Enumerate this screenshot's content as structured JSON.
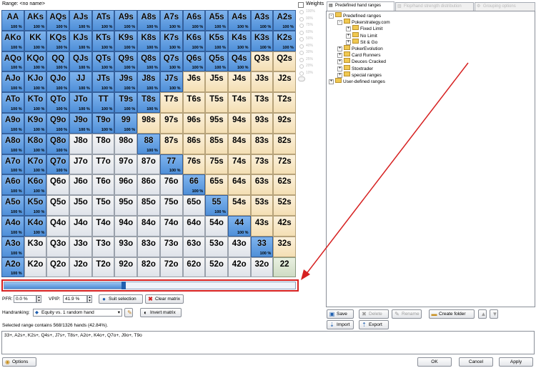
{
  "range_label": "Range: <no name>",
  "matrix": {
    "rows": [
      [
        [
          "AA",
          "s",
          1
        ],
        [
          "AKs",
          "s",
          1
        ],
        [
          "AQs",
          "s",
          1
        ],
        [
          "AJs",
          "s",
          1
        ],
        [
          "ATs",
          "s",
          1
        ],
        [
          "A9s",
          "s",
          1
        ],
        [
          "A8s",
          "s",
          1
        ],
        [
          "A7s",
          "s",
          1
        ],
        [
          "A6s",
          "s",
          1
        ],
        [
          "A5s",
          "s",
          1
        ],
        [
          "A4s",
          "s",
          1
        ],
        [
          "A3s",
          "s",
          1
        ],
        [
          "A2s",
          "s",
          1
        ]
      ],
      [
        [
          "AKo",
          "s",
          1
        ],
        [
          "KK",
          "s",
          1
        ],
        [
          "KQs",
          "s",
          1
        ],
        [
          "KJs",
          "s",
          1
        ],
        [
          "KTs",
          "s",
          1
        ],
        [
          "K9s",
          "s",
          1
        ],
        [
          "K8s",
          "s",
          1
        ],
        [
          "K7s",
          "s",
          1
        ],
        [
          "K6s",
          "s",
          1
        ],
        [
          "K5s",
          "s",
          1
        ],
        [
          "K4s",
          "s",
          1
        ],
        [
          "K3s",
          "s",
          1
        ],
        [
          "K2s",
          "s",
          1
        ]
      ],
      [
        [
          "AQo",
          "s",
          1
        ],
        [
          "KQo",
          "s",
          1
        ],
        [
          "QQ",
          "s",
          1
        ],
        [
          "QJs",
          "s",
          1
        ],
        [
          "QTs",
          "s",
          1
        ],
        [
          "Q9s",
          "s",
          1
        ],
        [
          "Q8s",
          "s",
          1
        ],
        [
          "Q7s",
          "s",
          1
        ],
        [
          "Q6s",
          "s",
          1
        ],
        [
          "Q5s",
          "s",
          1
        ],
        [
          "Q4s",
          "s",
          1
        ],
        [
          "Q3s",
          "su",
          0
        ],
        [
          "Q2s",
          "su",
          0
        ]
      ],
      [
        [
          "AJo",
          "s",
          1
        ],
        [
          "KJo",
          "s",
          1
        ],
        [
          "QJo",
          "s",
          1
        ],
        [
          "JJ",
          "s",
          1
        ],
        [
          "JTs",
          "s",
          1
        ],
        [
          "J9s",
          "s",
          1
        ],
        [
          "J8s",
          "s",
          1
        ],
        [
          "J7s",
          "s",
          1
        ],
        [
          "J6s",
          "su",
          0
        ],
        [
          "J5s",
          "su",
          0
        ],
        [
          "J4s",
          "su",
          0
        ],
        [
          "J3s",
          "su",
          0
        ],
        [
          "J2s",
          "su",
          0
        ]
      ],
      [
        [
          "ATo",
          "s",
          1
        ],
        [
          "KTo",
          "s",
          1
        ],
        [
          "QTo",
          "s",
          1
        ],
        [
          "JTo",
          "s",
          1
        ],
        [
          "TT",
          "s",
          1
        ],
        [
          "T9s",
          "s",
          1
        ],
        [
          "T8s",
          "s",
          1
        ],
        [
          "T7s",
          "su",
          0
        ],
        [
          "T6s",
          "su",
          0
        ],
        [
          "T5s",
          "su",
          0
        ],
        [
          "T4s",
          "su",
          0
        ],
        [
          "T3s",
          "su",
          0
        ],
        [
          "T2s",
          "su",
          0
        ]
      ],
      [
        [
          "A9o",
          "s",
          1
        ],
        [
          "K9o",
          "s",
          1
        ],
        [
          "Q9o",
          "s",
          1
        ],
        [
          "J9o",
          "s",
          1
        ],
        [
          "T9o",
          "s",
          1
        ],
        [
          "99",
          "s",
          1
        ],
        [
          "98s",
          "su",
          0
        ],
        [
          "97s",
          "su",
          0
        ],
        [
          "96s",
          "su",
          0
        ],
        [
          "95s",
          "su",
          0
        ],
        [
          "94s",
          "su",
          0
        ],
        [
          "93s",
          "su",
          0
        ],
        [
          "92s",
          "su",
          0
        ]
      ],
      [
        [
          "A8o",
          "s",
          1
        ],
        [
          "K8o",
          "s",
          1
        ],
        [
          "Q8o",
          "s",
          1
        ],
        [
          "J8o",
          "o",
          0
        ],
        [
          "T8o",
          "o",
          0
        ],
        [
          "98o",
          "o",
          0
        ],
        [
          "88",
          "s",
          1
        ],
        [
          "87s",
          "su",
          0
        ],
        [
          "86s",
          "su",
          0
        ],
        [
          "85s",
          "su",
          0
        ],
        [
          "84s",
          "su",
          0
        ],
        [
          "83s",
          "su",
          0
        ],
        [
          "82s",
          "su",
          0
        ]
      ],
      [
        [
          "A7o",
          "s",
          1
        ],
        [
          "K7o",
          "s",
          1
        ],
        [
          "Q7o",
          "s",
          1
        ],
        [
          "J7o",
          "o",
          0
        ],
        [
          "T7o",
          "o",
          0
        ],
        [
          "97o",
          "o",
          0
        ],
        [
          "87o",
          "o",
          0
        ],
        [
          "77",
          "s",
          1
        ],
        [
          "76s",
          "su",
          0
        ],
        [
          "75s",
          "su",
          0
        ],
        [
          "74s",
          "su",
          0
        ],
        [
          "73s",
          "su",
          0
        ],
        [
          "72s",
          "su",
          0
        ]
      ],
      [
        [
          "A6o",
          "s",
          1
        ],
        [
          "K6o",
          "s",
          1
        ],
        [
          "Q6o",
          "o",
          0
        ],
        [
          "J6o",
          "o",
          0
        ],
        [
          "T6o",
          "o",
          0
        ],
        [
          "96o",
          "o",
          0
        ],
        [
          "86o",
          "o",
          0
        ],
        [
          "76o",
          "o",
          0
        ],
        [
          "66",
          "s",
          1
        ],
        [
          "65s",
          "su",
          0
        ],
        [
          "64s",
          "su",
          0
        ],
        [
          "63s",
          "su",
          0
        ],
        [
          "62s",
          "su",
          0
        ]
      ],
      [
        [
          "A5o",
          "s",
          1
        ],
        [
          "K5o",
          "s",
          1
        ],
        [
          "Q5o",
          "o",
          0
        ],
        [
          "J5o",
          "o",
          0
        ],
        [
          "T5o",
          "o",
          0
        ],
        [
          "95o",
          "o",
          0
        ],
        [
          "85o",
          "o",
          0
        ],
        [
          "75o",
          "o",
          0
        ],
        [
          "65o",
          "o",
          0
        ],
        [
          "55",
          "s",
          1
        ],
        [
          "54s",
          "su",
          0
        ],
        [
          "53s",
          "su",
          0
        ],
        [
          "52s",
          "su",
          0
        ]
      ],
      [
        [
          "A4o",
          "s",
          1
        ],
        [
          "K4o",
          "s",
          1
        ],
        [
          "Q4o",
          "o",
          0
        ],
        [
          "J4o",
          "o",
          0
        ],
        [
          "T4o",
          "o",
          0
        ],
        [
          "94o",
          "o",
          0
        ],
        [
          "84o",
          "o",
          0
        ],
        [
          "74o",
          "o",
          0
        ],
        [
          "64o",
          "o",
          0
        ],
        [
          "54o",
          "o",
          0
        ],
        [
          "44",
          "s",
          1
        ],
        [
          "43s",
          "su",
          0
        ],
        [
          "42s",
          "su",
          0
        ]
      ],
      [
        [
          "A3o",
          "s",
          1
        ],
        [
          "K3o",
          "o",
          0
        ],
        [
          "Q3o",
          "o",
          0
        ],
        [
          "J3o",
          "o",
          0
        ],
        [
          "T3o",
          "o",
          0
        ],
        [
          "93o",
          "o",
          0
        ],
        [
          "83o",
          "o",
          0
        ],
        [
          "73o",
          "o",
          0
        ],
        [
          "63o",
          "o",
          0
        ],
        [
          "53o",
          "o",
          0
        ],
        [
          "43o",
          "o",
          0
        ],
        [
          "33",
          "s",
          1
        ],
        [
          "32s",
          "su",
          0
        ]
      ],
      [
        [
          "A2o",
          "s",
          1
        ],
        [
          "K2o",
          "o",
          0
        ],
        [
          "Q2o",
          "o",
          0
        ],
        [
          "J2o",
          "o",
          0
        ],
        [
          "T2o",
          "o",
          0
        ],
        [
          "92o",
          "o",
          0
        ],
        [
          "82o",
          "o",
          0
        ],
        [
          "72o",
          "o",
          0
        ],
        [
          "62o",
          "o",
          0
        ],
        [
          "52o",
          "o",
          0
        ],
        [
          "42o",
          "o",
          0
        ],
        [
          "32o",
          "o",
          0
        ],
        [
          "22",
          "p",
          0
        ]
      ]
    ],
    "percent_label": "100 %"
  },
  "weights": {
    "label": "Weights",
    "levels": [
      "100%",
      "90%",
      "75%",
      "60%",
      "50%",
      "40%",
      "30%",
      "25%",
      "20%",
      "10%"
    ]
  },
  "slider": {
    "value_percent": 41.9
  },
  "controls": {
    "pfr_label": "PFR:",
    "pfr_value": "0.0 %",
    "vpip_label": "VPIP:",
    "vpip_value": "41.9 %",
    "suit_selection": "Suit selection",
    "clear_matrix": "Clear matrix",
    "handranking_label": "Handranking:",
    "handranking_value": "Equity vs. 1 random hand",
    "invert_matrix": "Invert matrix"
  },
  "selected_info": "Selected range contains 568/1326 hands (42.84%).",
  "range_text": "33+, A2s+, K2s+, Q4s+, J7s+, T8s+, A2o+, K4o+, Q7o+, J9o+, T9o",
  "tabs": [
    {
      "label": "Predefined hand ranges",
      "active": true
    },
    {
      "label": "Flop/hand strength distribution",
      "active": false
    },
    {
      "label": "Grouping options",
      "active": false
    }
  ],
  "tree": [
    {
      "label": "Predefined ranges",
      "level": 0,
      "expander": "-"
    },
    {
      "label": "Pokerstrategy.com",
      "level": 1,
      "expander": "-"
    },
    {
      "label": "Fixed Limit",
      "level": 2,
      "expander": "+"
    },
    {
      "label": "No Limit",
      "level": 2,
      "expander": "+"
    },
    {
      "label": "Sit & Go",
      "level": 2,
      "expander": "+"
    },
    {
      "label": "PokerEvolution",
      "level": 1,
      "expander": "+"
    },
    {
      "label": "Card Runners",
      "level": 1,
      "expander": "+"
    },
    {
      "label": "Deuces Cracked",
      "level": 1,
      "expander": "+"
    },
    {
      "label": "Stoxtrader",
      "level": 1,
      "expander": "+"
    },
    {
      "label": "special ranges",
      "level": 1,
      "expander": "+"
    },
    {
      "label": "User-defined ranges",
      "level": 0,
      "expander": "+"
    }
  ],
  "panel_buttons": {
    "save": "Save",
    "delete": "Delete",
    "rename": "Rename",
    "create_folder": "Create folder",
    "import": "Import",
    "export": "Export"
  },
  "footer": {
    "options": "Options",
    "ok": "OK",
    "cancel": "Cancel",
    "apply": "Apply"
  },
  "colors": {
    "selected": "#4f8fd8",
    "unselected_suited": "#f4dfb4",
    "unselected_offsuit": "#dfe3ea",
    "annotation_red": "#d62020"
  }
}
